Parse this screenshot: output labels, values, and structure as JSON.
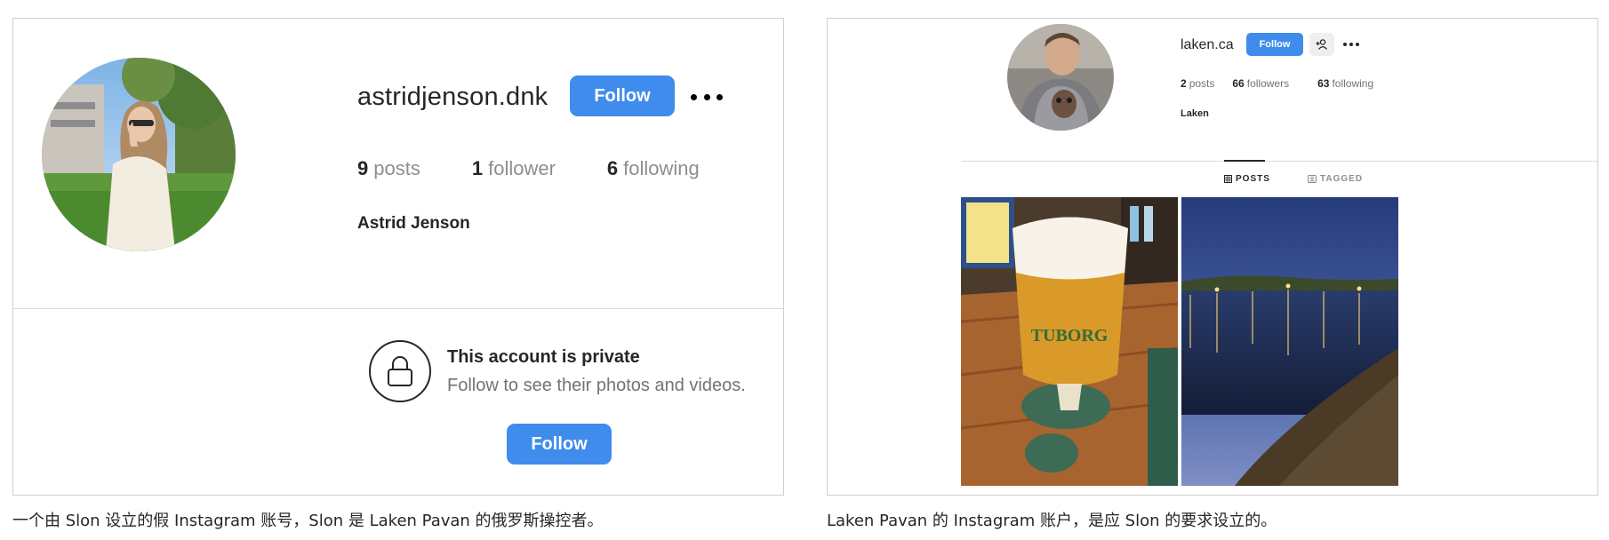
{
  "left_panel": {
    "username": "astridjenson.dnk",
    "follow_label": "Follow",
    "stats": [
      {
        "value": "9",
        "label": "posts"
      },
      {
        "value": "1",
        "label": "follower"
      },
      {
        "value": "6",
        "label": "following"
      }
    ],
    "full_name": "Astrid Jenson",
    "private_title": "This account is private",
    "private_subtitle": "Follow to see their photos and videos.",
    "follow_label_2": "Follow"
  },
  "right_panel": {
    "username": "laken.ca",
    "follow_label": "Follow",
    "stats": [
      {
        "value": "2",
        "label": "posts"
      },
      {
        "value": "66",
        "label": "followers"
      },
      {
        "value": "63",
        "label": "following"
      }
    ],
    "full_name": "Laken",
    "tabs": [
      {
        "label": "POSTS",
        "active": true
      },
      {
        "label": "TAGGED",
        "active": false
      }
    ],
    "post_1_text": "TUBORG"
  },
  "captions": {
    "left": "一个由 Slon 设立的假 Instagram 账号，Slon 是 Laken Pavan 的俄罗斯操控者。",
    "right": "Laken Pavan 的 Instagram 账户，是应 Slon 的要求设立的。"
  },
  "colors": {
    "accent": "#3f8ced",
    "text": "#262626",
    "muted": "#737373",
    "border": "#dbdbdb"
  },
  "icons": [
    "lock-icon",
    "more-icon",
    "suggested-user-icon",
    "grid-icon",
    "tagged-icon"
  ]
}
